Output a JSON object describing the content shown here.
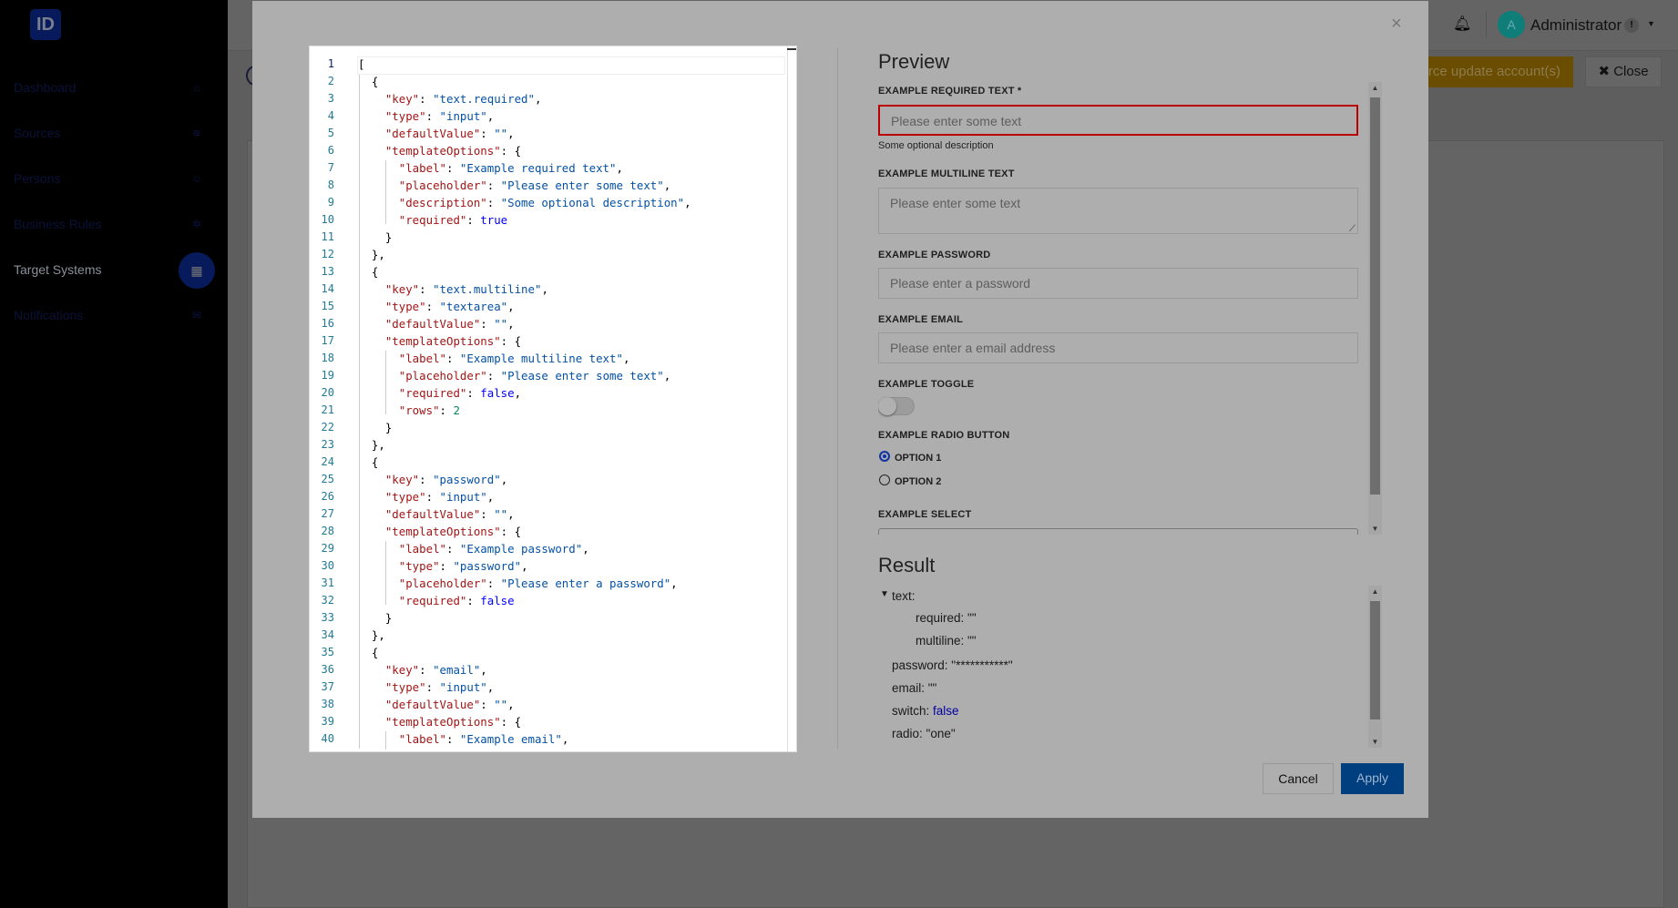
{
  "sidebar": {
    "logo": "ID",
    "items": [
      {
        "label": "Dashboard",
        "icon": "home-icon",
        "glyph": "⌂"
      },
      {
        "label": "Sources",
        "icon": "layers-icon",
        "glyph": "≋"
      },
      {
        "label": "Persons",
        "icon": "users-icon",
        "glyph": "☺"
      },
      {
        "label": "Business Rules",
        "icon": "rules-icon",
        "glyph": "✲"
      },
      {
        "label": "Target Systems",
        "icon": "grid-icon",
        "glyph": "▦",
        "active": true
      },
      {
        "label": "Notifications",
        "icon": "envelope-icon",
        "glyph": "✉"
      }
    ]
  },
  "header": {
    "user": "Administrator",
    "avatar": "A",
    "badge": "!",
    "force_update": "Force update account(s)",
    "close": "Close"
  },
  "modal": {
    "close": "×",
    "editor": {
      "lines": [
        "[",
        "  {",
        "    \"key\": \"text.required\",",
        "    \"type\": \"input\",",
        "    \"defaultValue\": \"\",",
        "    \"templateOptions\": {",
        "      \"label\": \"Example required text\",",
        "      \"placeholder\": \"Please enter some text\",",
        "      \"description\": \"Some optional description\",",
        "      \"required\": true",
        "    }",
        "  },",
        "  {",
        "    \"key\": \"text.multiline\",",
        "    \"type\": \"textarea\",",
        "    \"defaultValue\": \"\",",
        "    \"templateOptions\": {",
        "      \"label\": \"Example multiline text\",",
        "      \"placeholder\": \"Please enter some text\",",
        "      \"required\": false,",
        "      \"rows\": 2",
        "    }",
        "  },",
        "  {",
        "    \"key\": \"password\",",
        "    \"type\": \"input\",",
        "    \"defaultValue\": \"\",",
        "    \"templateOptions\": {",
        "      \"label\": \"Example password\",",
        "      \"type\": \"password\",",
        "      \"placeholder\": \"Please enter a password\",",
        "      \"required\": false",
        "    }",
        "  },",
        "  {",
        "    \"key\": \"email\",",
        "    \"type\": \"input\",",
        "    \"defaultValue\": \"\",",
        "    \"templateOptions\": {",
        "      \"label\": \"Example email\","
      ]
    },
    "preview": {
      "title": "Preview",
      "required_label": "EXAMPLE REQUIRED TEXT *",
      "required_placeholder": "Please enter some text",
      "required_desc": "Some optional description",
      "multiline_label": "EXAMPLE MULTILINE TEXT",
      "multiline_placeholder": "Please enter some text",
      "password_label": "EXAMPLE PASSWORD",
      "password_placeholder": "Please enter a password",
      "email_label": "EXAMPLE EMAIL",
      "email_placeholder": "Please enter a email address",
      "toggle_label": "EXAMPLE TOGGLE",
      "toggle_on": false,
      "radio_label": "EXAMPLE RADIO BUTTON",
      "option1": "OPTION 1",
      "option2": "OPTION 2",
      "selected": "option1",
      "select_label": "EXAMPLE SELECT"
    },
    "result": {
      "title": "Result",
      "text_key": "text:",
      "required": "required: \"\"",
      "multiline": "multiline: \"\"",
      "password": "password: \"***********\"",
      "email": "email: \"\"",
      "switch_key": "switch:",
      "switch_val": "false",
      "radio": "radio: \"one\""
    },
    "cancel": "Cancel",
    "apply": "Apply"
  },
  "colors": {
    "accent": "#003f7f",
    "error": "#b00000",
    "sidebar_active": "#071a5c",
    "force_update": "#6b4d00"
  }
}
